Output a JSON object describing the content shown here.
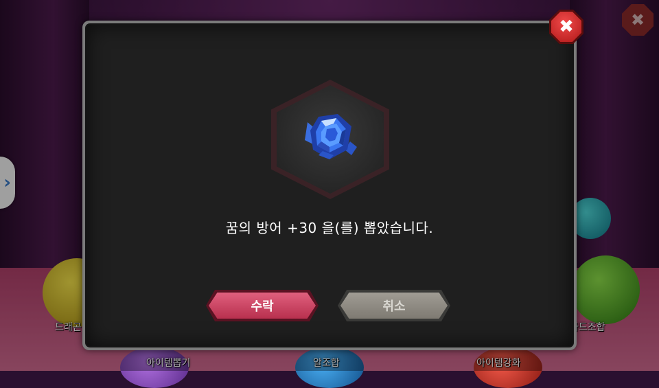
{
  "background_menu": {
    "labels": [
      "드래곤",
      "아이템뽑기",
      "알조합",
      "아이템강화",
      "카드조합"
    ]
  },
  "side_arrow": "›",
  "bg_close": "✖",
  "dialog": {
    "close_symbol": "✖",
    "item_icon": "blue-gem-icon",
    "message": "꿈의 방어 +30 을(를) 뽑았습니다.",
    "accept_label": "수락",
    "cancel_label": "취소"
  },
  "colors": {
    "accept": "#c8405e",
    "cancel": "#8e8a82",
    "close": "#d02a2a"
  }
}
